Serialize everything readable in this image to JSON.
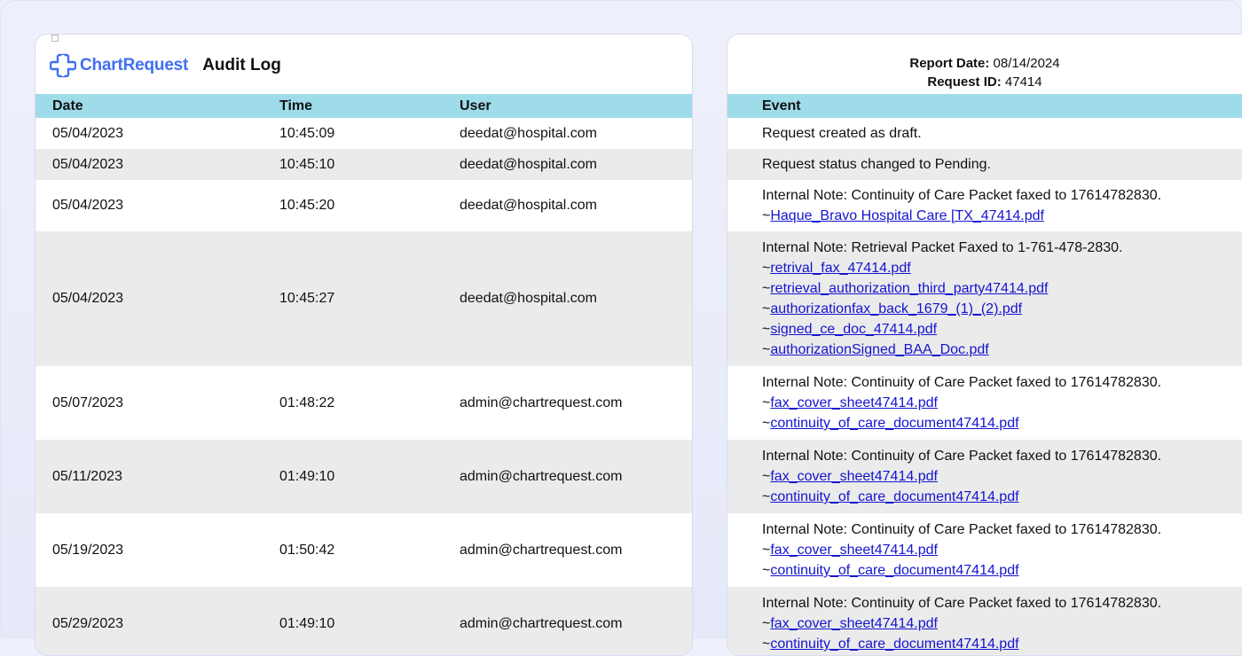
{
  "brand": {
    "name": "ChartRequest",
    "doc_title": "Audit Log"
  },
  "report": {
    "date_label": "Report Date:",
    "date_value": "08/14/2024",
    "request_label": "Request ID:",
    "request_value": "47414"
  },
  "columns": {
    "date": "Date",
    "time": "Time",
    "user": "User",
    "event": "Event"
  },
  "rows": [
    {
      "date": "05/04/2023",
      "time": "10:45:09",
      "user": "deedat@hospital.com",
      "event": {
        "text": "Request created as draft.",
        "files": []
      }
    },
    {
      "date": "05/04/2023",
      "time": "10:45:10",
      "user": "deedat@hospital.com",
      "event": {
        "text": "Request status changed to Pending.",
        "files": []
      }
    },
    {
      "date": "05/04/2023",
      "time": "10:45:20",
      "user": "deedat@hospital.com",
      "event": {
        "text": "Internal Note: Continuity of Care Packet faxed to 17614782830.",
        "files": [
          "Haque_Bravo Hospital Care [TX_47414.pdf"
        ]
      }
    },
    {
      "date": "05/04/2023",
      "time": "10:45:27",
      "user": "deedat@hospital.com",
      "event": {
        "text": "Internal Note: Retrieval Packet Faxed to 1-761-478-2830.",
        "files": [
          "retrival_fax_47414.pdf",
          "retrieval_authorization_third_party47414.pdf",
          "authorizationfax_back_1679_(1)_(2).pdf",
          "signed_ce_doc_47414.pdf",
          "authorizationSigned_BAA_Doc.pdf"
        ]
      }
    },
    {
      "date": "05/07/2023",
      "time": "01:48:22",
      "user": "admin@chartrequest.com",
      "event": {
        "text": "Internal Note: Continuity of Care Packet faxed to 17614782830.",
        "files": [
          "fax_cover_sheet47414.pdf",
          "continuity_of_care_document47414.pdf"
        ]
      }
    },
    {
      "date": "05/11/2023",
      "time": "01:49:10",
      "user": "admin@chartrequest.com",
      "event": {
        "text": "Internal Note: Continuity of Care Packet faxed to 17614782830.",
        "files": [
          "fax_cover_sheet47414.pdf",
          "continuity_of_care_document47414.pdf"
        ]
      }
    },
    {
      "date": "05/19/2023",
      "time": "01:50:42",
      "user": "admin@chartrequest.com",
      "event": {
        "text": "Internal Note: Continuity of Care Packet faxed to 17614782830.",
        "files": [
          "fax_cover_sheet47414.pdf",
          "continuity_of_care_document47414.pdf"
        ]
      }
    },
    {
      "date": "05/29/2023",
      "time": "01:49:10",
      "user": "admin@chartrequest.com",
      "event": {
        "text": "Internal Note: Continuity of Care Packet faxed to 17614782830.",
        "files": [
          "fax_cover_sheet47414.pdf",
          "continuity_of_care_document47414.pdf"
        ]
      }
    }
  ],
  "colors": {
    "header_bg": "#9fdcea",
    "alt_row": "#ebebeb",
    "link": "#1414d0",
    "brand": "#3f6ff2"
  },
  "icons": {
    "logo": "chartrequest-cross-logo"
  }
}
